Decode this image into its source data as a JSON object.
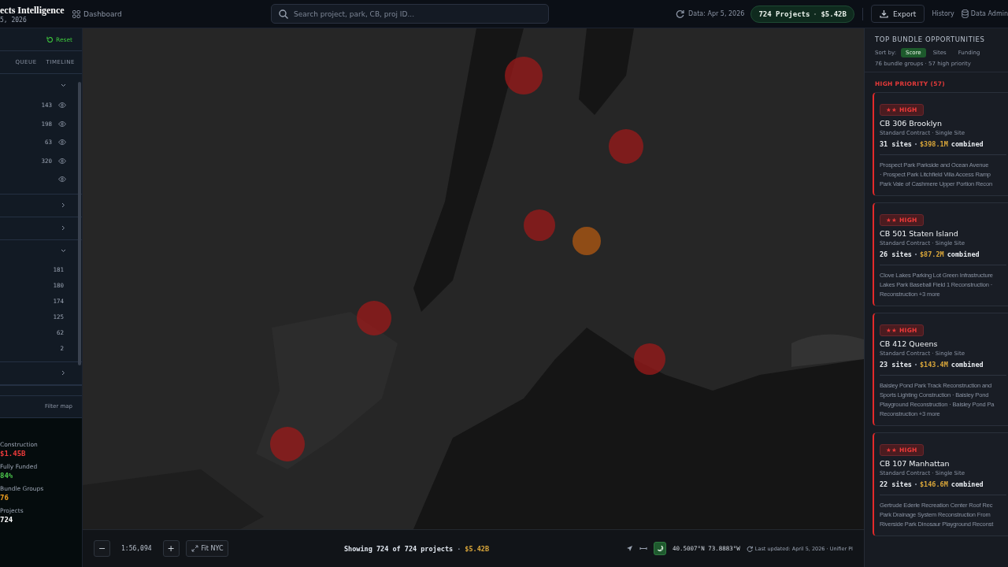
{
  "header": {
    "brand": "ects Intelligence",
    "date": "5, 2026",
    "nav_link": "Dashboard",
    "search": {
      "placeholder": "Search project, park, CB, proj ID..."
    },
    "data_date": "Data: Apr 5, 2026",
    "pill": {
      "count": "724 Projects",
      "amount": "$5.42B"
    },
    "export": "Export",
    "history": "History",
    "admin": "Data Admin"
  },
  "sidebar": {
    "reset": "Reset",
    "columns": [
      "QUEUE",
      "TIMELINE"
    ],
    "sections": [
      {
        "expanded": true,
        "kind": "toggles",
        "rows": [
          {
            "count": "143"
          },
          {
            "count": "198"
          },
          {
            "count": "63"
          },
          {
            "count": "320"
          },
          {}
        ]
      },
      {
        "expanded": false
      },
      {
        "expanded": false
      },
      {
        "expanded": true,
        "kind": "counts",
        "rows": [
          {
            "count": "181"
          },
          {
            "count": "180"
          },
          {
            "count": "174"
          },
          {
            "count": "125"
          },
          {
            "count": "62"
          },
          {
            "count": "2"
          }
        ]
      },
      {
        "expanded": false
      }
    ],
    "filter_map": "Filter map",
    "stats": [
      {
        "label": "Construction",
        "value": "$1.45B",
        "color": "#ef3b3b"
      },
      {
        "label": "Fully Funded",
        "value": "84%",
        "color": "#4cc64c"
      },
      {
        "label": "Bundle Groups",
        "value": "76",
        "color": "#f0a020"
      },
      {
        "label": "Projects",
        "value": "724",
        "color": "#ffffff"
      }
    ]
  },
  "map_bar": {
    "zoom_out": "−",
    "scale": "1:56,094",
    "zoom_in": "+",
    "fit": "Fit NYC",
    "showing": "Showing 724 of 724 projects",
    "separator": "·",
    "total": "$5.42B",
    "dark_mode": true,
    "coords": "40.5007°N 73.8883°W",
    "updated": "Last updated: April 5, 2026 · Unifier PI"
  },
  "panel": {
    "title": "TOP BUNDLE OPPORTUNITIES",
    "sort_label": "Sort by:",
    "sort_options": [
      {
        "label": "Score",
        "selected": true
      },
      {
        "label": "Sites",
        "selected": false
      },
      {
        "label": "Funding",
        "selected": false
      }
    ],
    "summary": "76 bundle groups · 57 high priority",
    "group_heading": "HIGH PRIORITY (57)",
    "cards": [
      {
        "badge": "★★ HIGH",
        "title": "CB 306 Brooklyn",
        "subtitle": "Standard Contract · Single Site",
        "sites": "31 sites",
        "amount": "$398.1M",
        "suffix": "combined",
        "lines": [
          "Prospect Park Parkside and Ocean Avenue",
          "· Prospect Park Litchfield Villa Access Ramp",
          "Park Vale of Cashmere Upper Portion Recon"
        ]
      },
      {
        "badge": "★★ HIGH",
        "title": "CB 501 Staten Island",
        "subtitle": "Standard Contract · Single Site",
        "sites": "26 sites",
        "amount": "$87.2M",
        "suffix": "combined",
        "lines": [
          "Clove Lakes Parking Lot Green Infrastructure",
          "Lakes Park Baseball Field 1 Reconstruction ·",
          "Reconstruction +3 more"
        ]
      },
      {
        "badge": "★★ HIGH",
        "title": "CB 412 Queens",
        "subtitle": "Standard Contract · Single Site",
        "sites": "23 sites",
        "amount": "$143.4M",
        "suffix": "combined",
        "lines": [
          "Baisley Pond Park Track Reconstruction and",
          "Sports Lighting Construction · Baisley Pond",
          "Playground Reconstruction · Baisley Pond Pa",
          "Reconstruction +3 more"
        ]
      },
      {
        "badge": "★★ HIGH",
        "title": "CB 107 Manhattan",
        "subtitle": "Standard Contract · Single Site",
        "sites": "22 sites",
        "amount": "$146.6M",
        "suffix": "combined",
        "lines": [
          "Gertrude Ederle Recreation Center Roof Rec",
          "Park Drainage System Reconstruction From",
          "Riverside Park Dinosaur Playground Reconst"
        ]
      }
    ]
  }
}
